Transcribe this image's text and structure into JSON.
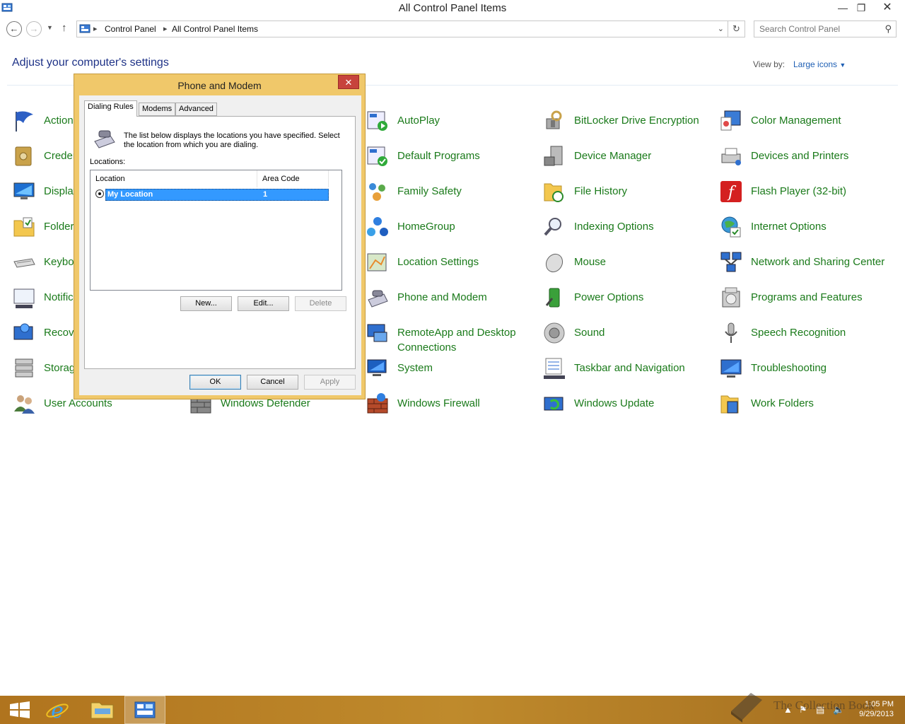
{
  "window": {
    "title": "All Control Panel Items"
  },
  "address": {
    "crumbs": [
      "Control Panel",
      "All Control Panel Items"
    ],
    "search_placeholder": "Search Control Panel"
  },
  "header": {
    "heading": "Adjust your computer's settings",
    "view_by_label": "View by:",
    "view_by_value": "Large icons"
  },
  "items": [
    "Action Center",
    "Credential Manager",
    "Display",
    "Folder Options",
    "Keyboard",
    "Notification Area Icons",
    "Recovery",
    "Storage Spaces",
    "User Accounts",
    "Windows Defender",
    "AutoPlay",
    "Default Programs",
    "Family Safety",
    "HomeGroup",
    "Location Settings",
    "Phone and Modem",
    "RemoteApp and Desktop Connections",
    "System",
    "Windows Firewall",
    "BitLocker Drive Encryption",
    "Device Manager",
    "File History",
    "Indexing Options",
    "Mouse",
    "Power Options",
    "Sound",
    "Taskbar and Navigation",
    "Windows Update",
    "Color Management",
    "Devices and Printers",
    "Flash Player (32-bit)",
    "Internet Options",
    "Network and Sharing Center",
    "Programs and Features",
    "Speech Recognition",
    "Troubleshooting",
    "Work Folders"
  ],
  "dialog": {
    "title": "Phone and Modem",
    "tabs": [
      "Dialing Rules",
      "Modems",
      "Advanced"
    ],
    "description": "The list below displays the locations you have specified. Select the location from which you are dialing.",
    "locations_label": "Locations:",
    "columns": [
      "Location",
      "Area Code"
    ],
    "rows": [
      {
        "location": "My Location",
        "area_code": "1"
      }
    ],
    "buttons": {
      "new": "New...",
      "edit": "Edit...",
      "delete": "Delete",
      "ok": "OK",
      "cancel": "Cancel",
      "apply": "Apply"
    }
  },
  "taskbar": {
    "time": "1:05 PM",
    "date": "9/29/2013",
    "watermark": "The Collection Book"
  }
}
